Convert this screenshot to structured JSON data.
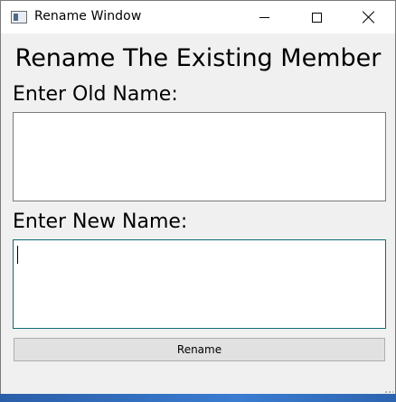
{
  "window": {
    "title": "Rename Window"
  },
  "form": {
    "heading": "Rename The Existing Member",
    "old_label": "Enter Old Name:",
    "old_value": "",
    "new_label": "Enter New Name:",
    "new_value": "",
    "rename_label": "Rename"
  },
  "icons": {
    "app": "app-window-icon",
    "minimize": "minimize-icon",
    "maximize": "maximize-icon",
    "close": "close-icon"
  },
  "colors": {
    "window_bg": "#f0f0f0",
    "focused_border": "#0f6b7a",
    "button_bg": "#e1e1e1"
  }
}
